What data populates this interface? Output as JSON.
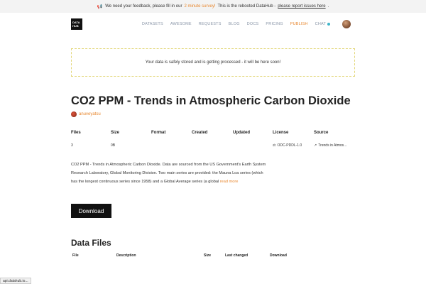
{
  "banner": {
    "prefix": "We need your feedback, please fill in our",
    "survey_link": "2 minute survey!",
    "middle": "This is the rebooted DataHub -",
    "report_link": "please report issues here",
    "suffix": "."
  },
  "logo": {
    "line1": "DATA",
    "line2": "HUB"
  },
  "nav": {
    "items": [
      "DATASETS",
      "AWESOME",
      "REQUESTS",
      "BLOG",
      "DOCS",
      "PRICING",
      "PUBLISH",
      "CHAT"
    ]
  },
  "notice": {
    "text": "Your data is safely stored and is getting processed - it will be here soon!"
  },
  "dataset": {
    "title": "CO2 PPM - Trends in Atmospheric Carbon Dioxide",
    "author": "anuveyatsu",
    "headers": [
      "Files",
      "Size",
      "Format",
      "Created",
      "Updated",
      "License",
      "Source"
    ],
    "values": {
      "files": "3",
      "size": "0B",
      "license": "ODC-PDDL-1.0",
      "source": "Trends in Atmos..."
    },
    "description": "CO2 PPM - Trends in Atmospheric Carbon Dioxide. Data are sourced from the US Government's Earth System Research Laboratory, Global Monitoring Division. Two main series are provided: the Mauna Loa series (which has the longest continuous series since 1958) and a Global Average series (a global",
    "read_more": "read more",
    "download_label": "Download"
  },
  "data_files": {
    "title": "Data Files",
    "headers": [
      "File",
      "Description",
      "Size",
      "Last changed",
      "Download"
    ]
  },
  "status_bar": {
    "text": "api.datahub.io..."
  },
  "colors": {
    "accent": "#e8872e",
    "nav": "#8a96a8",
    "chat_dot": "#3fb5c9"
  }
}
